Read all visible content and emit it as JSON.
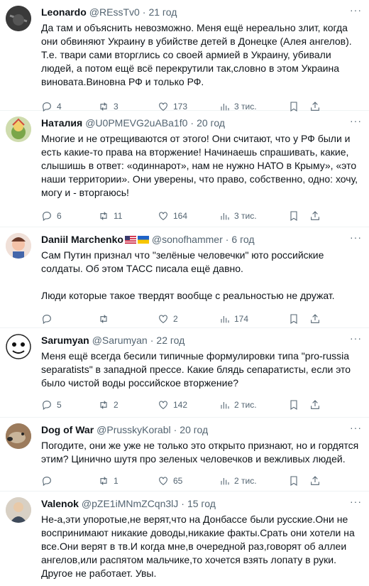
{
  "icons": {
    "reply": "reply-icon",
    "retweet": "retweet-icon",
    "like": "heart-icon",
    "views": "views-icon",
    "bookmark": "bookmark-icon",
    "share": "share-icon"
  },
  "colors": {
    "text": "#0f1419",
    "muted": "#536471",
    "border": "#eff3f4"
  },
  "tweets": [
    {
      "name": "Leonardo",
      "handle": "@REssTv0",
      "time": "21 год",
      "text": "Да там и объяснить невозможно. Меня ещё нереально злит, когда они обвиняют Украину в убийстве детей в Донецке (Алея ангелов). Т.е. твари сами вторглись со своей армией в Украину, убивали людей, а потом ещё всё перекрутили так,словно в этом Украина виновата.Виновна РФ и только РФ.",
      "replies": "4",
      "retweets": "3",
      "likes": "173",
      "views": "3 тис."
    },
    {
      "name": "Наталия",
      "handle": "@U0PMEVG2uABa1f0",
      "time": "20 год",
      "text": "Многие и не отрещиваются от этого! Они считают, что у РФ были и есть какие-то права на вторжение! Начинаешь спрашивать, какие, слышишь в ответ: «одиннарот», нам не нужно НАТО в Крыму», «это наши территории». Они уверены, что право, собственно, одно: хочу, могу и - вторгаюсь!",
      "replies": "6",
      "retweets": "11",
      "likes": "164",
      "views": "3 тис."
    },
    {
      "name": "Daniil Marchenko",
      "handle": "@sonofhammer",
      "time": "6 год",
      "text": "Сам Путин признал что \"зелёные человечки\" юто российские солдаты. Об этом ТАСС писала ещё давно.\n\nЛюди которые такое твердят вообще с реальностью не дружат.",
      "replies": "",
      "retweets": "",
      "likes": "2",
      "views": "174"
    },
    {
      "name": "Sarumyan",
      "handle": "@Sarumyan",
      "time": "22 год",
      "text": "Меня ещё всегда бесили типичные формулировки типа \"pro-russia separatists\" в западной прессе. Какие блядь сепаратисты, если это было чистой воды российское вторжение?",
      "replies": "5",
      "retweets": "2",
      "likes": "142",
      "views": "2 тис."
    },
    {
      "name": "Dog of War",
      "handle": "@PrusskyKorabl",
      "time": "20 год",
      "text": "Погодите, они же уже не только это открыто признают, но и гордятся этим? Цинично шутя про зеленых человечков и вежливых людей.",
      "replies": "",
      "retweets": "1",
      "likes": "65",
      "views": "2 тис."
    },
    {
      "name": "Valenok",
      "handle": "@pZE1iMNmZCqn3lJ",
      "time": "15 год",
      "text": "Не-а,эти упоротые,не верят,что на Донбассе были русские.Они не воспринимают никакие доводы,никакие факты.Срать они хотели на все.Они верят в тв.И когда мне,в очередной раз,говорят об аллеи ангелов,или распятом мальчике,то хочется взять лопату в руки. Другое не работает. Увы.",
      "replies": "",
      "retweets": "",
      "likes": "",
      "views": ""
    }
  ]
}
